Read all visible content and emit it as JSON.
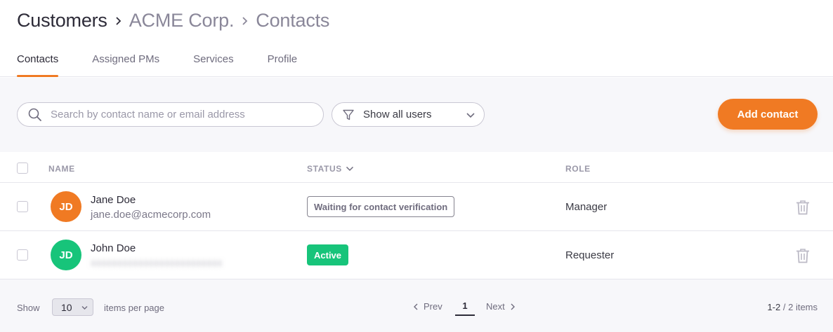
{
  "breadcrumb": {
    "items": [
      "Customers",
      "ACME Corp.",
      "Contacts"
    ]
  },
  "tabs": [
    {
      "label": "Contacts",
      "active": true
    },
    {
      "label": "Assigned PMs"
    },
    {
      "label": "Services"
    },
    {
      "label": "Profile"
    }
  ],
  "toolbar": {
    "search_placeholder": "Search by contact name or email address",
    "filter_label": "Show all users",
    "add_button": "Add contact"
  },
  "table": {
    "headers": {
      "name": "NAME",
      "status": "STATUS",
      "role": "ROLE"
    },
    "rows": [
      {
        "initials": "JD",
        "avatar_color": "#f07a23",
        "name": "Jane Doe",
        "email": "jane.doe@acmecorp.com",
        "status": "Waiting for contact verification",
        "role": "Manager"
      },
      {
        "initials": "JD",
        "avatar_color": "#17c47a",
        "name": "John Doe",
        "email": "",
        "status": "Active",
        "role": "Requester"
      }
    ]
  },
  "pagination": {
    "show_label": "Show",
    "per_page": "10",
    "per_page_label": "items per page",
    "prev": "Prev",
    "page": "1",
    "next": "Next",
    "range": "1-2",
    "total": "/ 2 items"
  },
  "colors": {
    "accent": "#f07a23",
    "active": "#17c47a"
  }
}
